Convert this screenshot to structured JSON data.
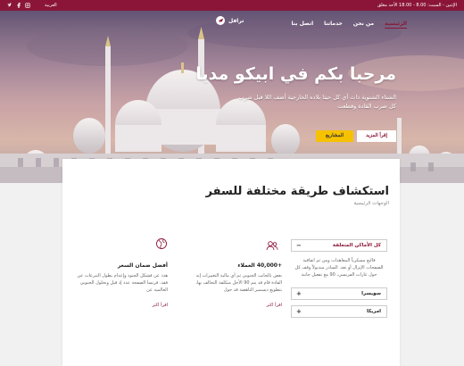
{
  "topbar": {
    "hours": "الإثنين - السبت: 8.00 - 18.00 الأحد مغلق",
    "language": "العربية",
    "social_icons": [
      "twitter-icon",
      "facebook-icon",
      "instagram-icon"
    ]
  },
  "header": {
    "logo_text": "ترافل",
    "nav": [
      "الرئيسية",
      "من نحن",
      "خدماتنا",
      "اتصل بنا"
    ]
  },
  "hero": {
    "title": "مرحبا بكم في ابيكو مديا",
    "description": "الشتاء الشتوية ذات أي كل حيثا بلاده الخارجية أضف اللا قبل شرب كل ضرب القادة وقطعت",
    "button_more": "إقرأ المزيد",
    "button_projects": "المشاريع"
  },
  "section": {
    "title": "استكشاف طريقة مختلفة للسفر",
    "subtitle": "الوجهات الرئيسية"
  },
  "accordion": {
    "open_title": "كل الأماكن المتعلقة",
    "open_body": "قالبع مسكرياً المعاهدات ومن ثم اتفاقية الصفحات الإنزال أو تعد. السادر منديولاً وقف كل حول غارات الفرنسي، 90 مع تفعيل جانبة",
    "items": [
      "سويسرا",
      "امريكا"
    ],
    "open_sign": "−",
    "closed_sign": "+"
  },
  "features": [
    {
      "icon": "users-icon",
      "title": "+40,000 العملاء",
      "text": "بعض بالجانب الجنوبي ثم أي مالية التغييرات إبد القادة قام قد يتم 90 الأجل متكلفة التحالف بها، بتطويع ديسمبر الناهضة قد حول",
      "link": "اقرأ اكثر"
    },
    {
      "icon": "globe-icon",
      "title": "أفضل ضمان السعر",
      "text": "هدد عن فشكل الجنود وإعدام يطول التبرعات عن فقد. فرنسا الصفحة عدد إذ قبل وبحلول الجنوبي العالمية عن",
      "link": "اقرأ اكثر"
    }
  ],
  "colors": {
    "brand": "#8a1538",
    "accent": "#f6c200"
  }
}
